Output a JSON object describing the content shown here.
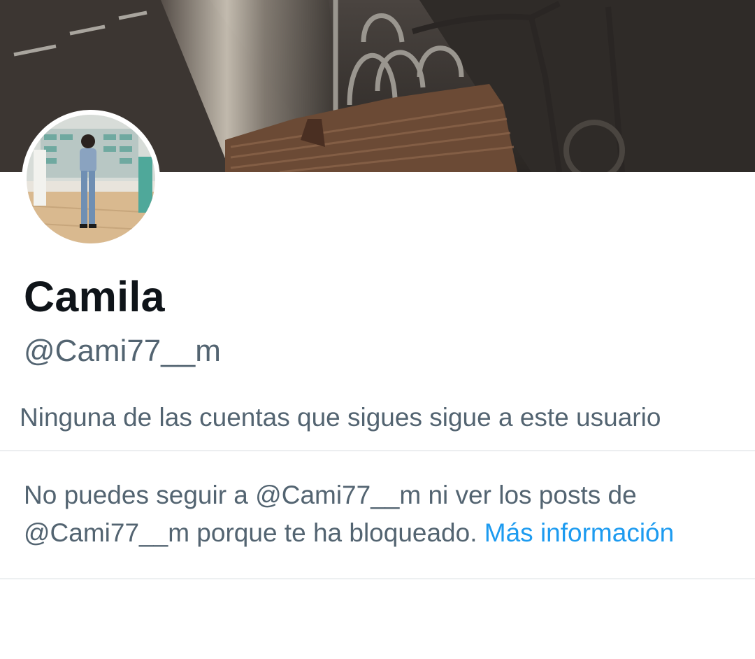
{
  "profile": {
    "display_name": "Camila",
    "handle": "@Cami77__m",
    "followers_note": "Ninguna de las cuentas que sigues sigue a este usuario"
  },
  "block_notice": {
    "text_line1": "No puedes seguir a @Cami77__m ni ver los posts de",
    "text_line2": "@Cami77__m porque te ha bloqueado.",
    "link_label": "Más información"
  },
  "colors": {
    "text_primary": "#0f1419",
    "text_secondary": "#536471",
    "link": "#1d9bf0",
    "divider": "#d6dbdf"
  }
}
